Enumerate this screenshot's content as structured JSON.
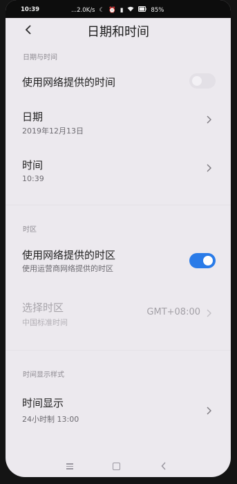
{
  "status_bar": {
    "time": "10:39",
    "net_speed": "...2.0K/s",
    "battery": "85%"
  },
  "header": {
    "title": "日期和时间"
  },
  "sections": {
    "date_time": "日期与时间",
    "timezone": "时区",
    "display_style": "时间显示样式"
  },
  "rows": {
    "use_network_time": {
      "title": "使用网络提供的时间",
      "enabled": false
    },
    "date": {
      "title": "日期",
      "value": "2019年12月13日"
    },
    "time": {
      "title": "时间",
      "value": "10:39"
    },
    "use_network_timezone": {
      "title": "使用网络提供的时区",
      "subtitle": "使用运营商网络提供的时区",
      "enabled": true
    },
    "select_timezone": {
      "title": "选择时区",
      "subtitle": "中国标准时间",
      "value": "GMT+08:00"
    },
    "time_display": {
      "title": "时间显示",
      "value": "24小时制 13:00"
    }
  },
  "icons": [
    "back-icon",
    "chevron-right-icon",
    "nav-menu-icon",
    "nav-home-icon",
    "nav-back-icon",
    "wifi-icon",
    "battery-icon",
    "moon-icon",
    "alarm-icon",
    "signal-icon"
  ],
  "colors": {
    "accent": "#2a7be8",
    "background": "#ece9ee"
  }
}
